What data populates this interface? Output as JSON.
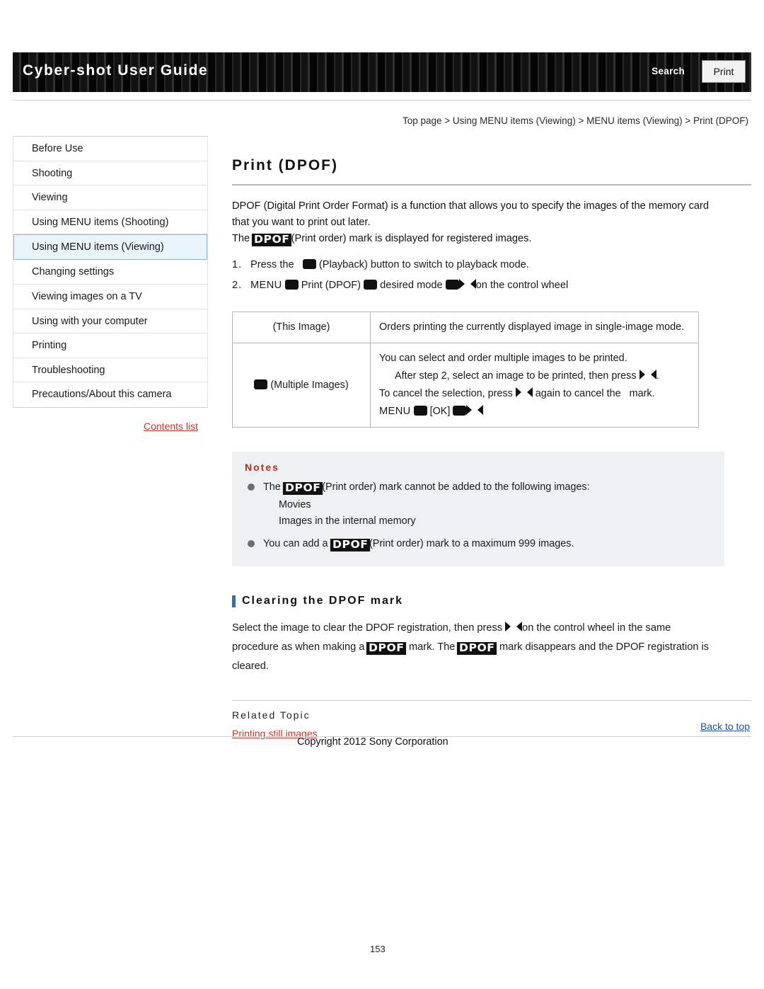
{
  "header": {
    "title": "Cyber-shot User Guide",
    "search_label": "Search",
    "print_label": "Print"
  },
  "breadcrumb": "Top page > Using MENU items (Viewing) > MENU items (Viewing) > Print (DPOF)",
  "sidebar": {
    "items": [
      {
        "label": "Before Use",
        "active": false
      },
      {
        "label": "Shooting",
        "active": false
      },
      {
        "label": "Viewing",
        "active": false
      },
      {
        "label": "Using MENU items (Shooting)",
        "active": false
      },
      {
        "label": "Using MENU items (Viewing)",
        "active": true
      },
      {
        "label": "Changing settings",
        "active": false
      },
      {
        "label": "Viewing images on a TV",
        "active": false
      },
      {
        "label": "Using with your computer",
        "active": false
      },
      {
        "label": "Printing",
        "active": false
      },
      {
        "label": "Troubleshooting",
        "active": false
      },
      {
        "label": "Precautions/About this camera",
        "active": false
      }
    ],
    "contents_list_label": "Contents list"
  },
  "main": {
    "page_title": "Print (DPOF)",
    "intro_line1": "DPOF (Digital Print Order Format) is a function that allows you to specify the images of the memory card",
    "intro_line2": "that you want to print out later.",
    "intro_line3_pre": "The ",
    "intro_line3_post": "(Print order) mark is displayed for registered images.",
    "dpof_glyph": "DPOF",
    "step1_num": "1.",
    "step1_pre": "Press the",
    "step1_post": "(Playback) button to switch to playback mode.",
    "step2_num": "2.",
    "step2_menu": "MENU",
    "step2_mid": "Print (DPOF)",
    "step2_mode": "desired mode",
    "step2_end": "on the control wheel",
    "table": {
      "rows": [
        {
          "name": "(This Image)",
          "has_icon": false,
          "desc_lines": [
            "Orders printing the currently displayed image in single-image mode."
          ]
        },
        {
          "name": "(Multiple Images)",
          "has_icon": true,
          "desc_lines": [
            "You can select and order multiple images to be printed.",
            "After step 2, select an image to be printed, then press",
            "To cancel the selection, press",
            "again to cancel the",
            "mark.",
            "MENU",
            "[OK]"
          ]
        }
      ]
    },
    "notes": {
      "title": "Notes",
      "note1_pre": "The",
      "note1_post": "(Print order) mark cannot be added to the following images:",
      "note1_sub1": "Movies",
      "note1_sub2": "Images in the internal memory",
      "note2_pre": "You can add a",
      "note2_post": "(Print order) mark to a maximum 999 images."
    },
    "subsection": {
      "heading": "Clearing the DPOF mark",
      "line1_pre": "Select the image to clear the DPOF registration, then press",
      "line1_post": "on the control wheel in the same",
      "line2_pre": "procedure as when making a",
      "line2_mid": "mark. The",
      "line2_post": "mark disappears and the DPOF registration is",
      "line3": "cleared."
    },
    "related": {
      "title": "Related Topic",
      "link": "Printing still images"
    }
  },
  "footer": {
    "back_to_top": "Back to top",
    "copyright": "Copyright 2012 Sony Corporation",
    "page_number": "153"
  }
}
